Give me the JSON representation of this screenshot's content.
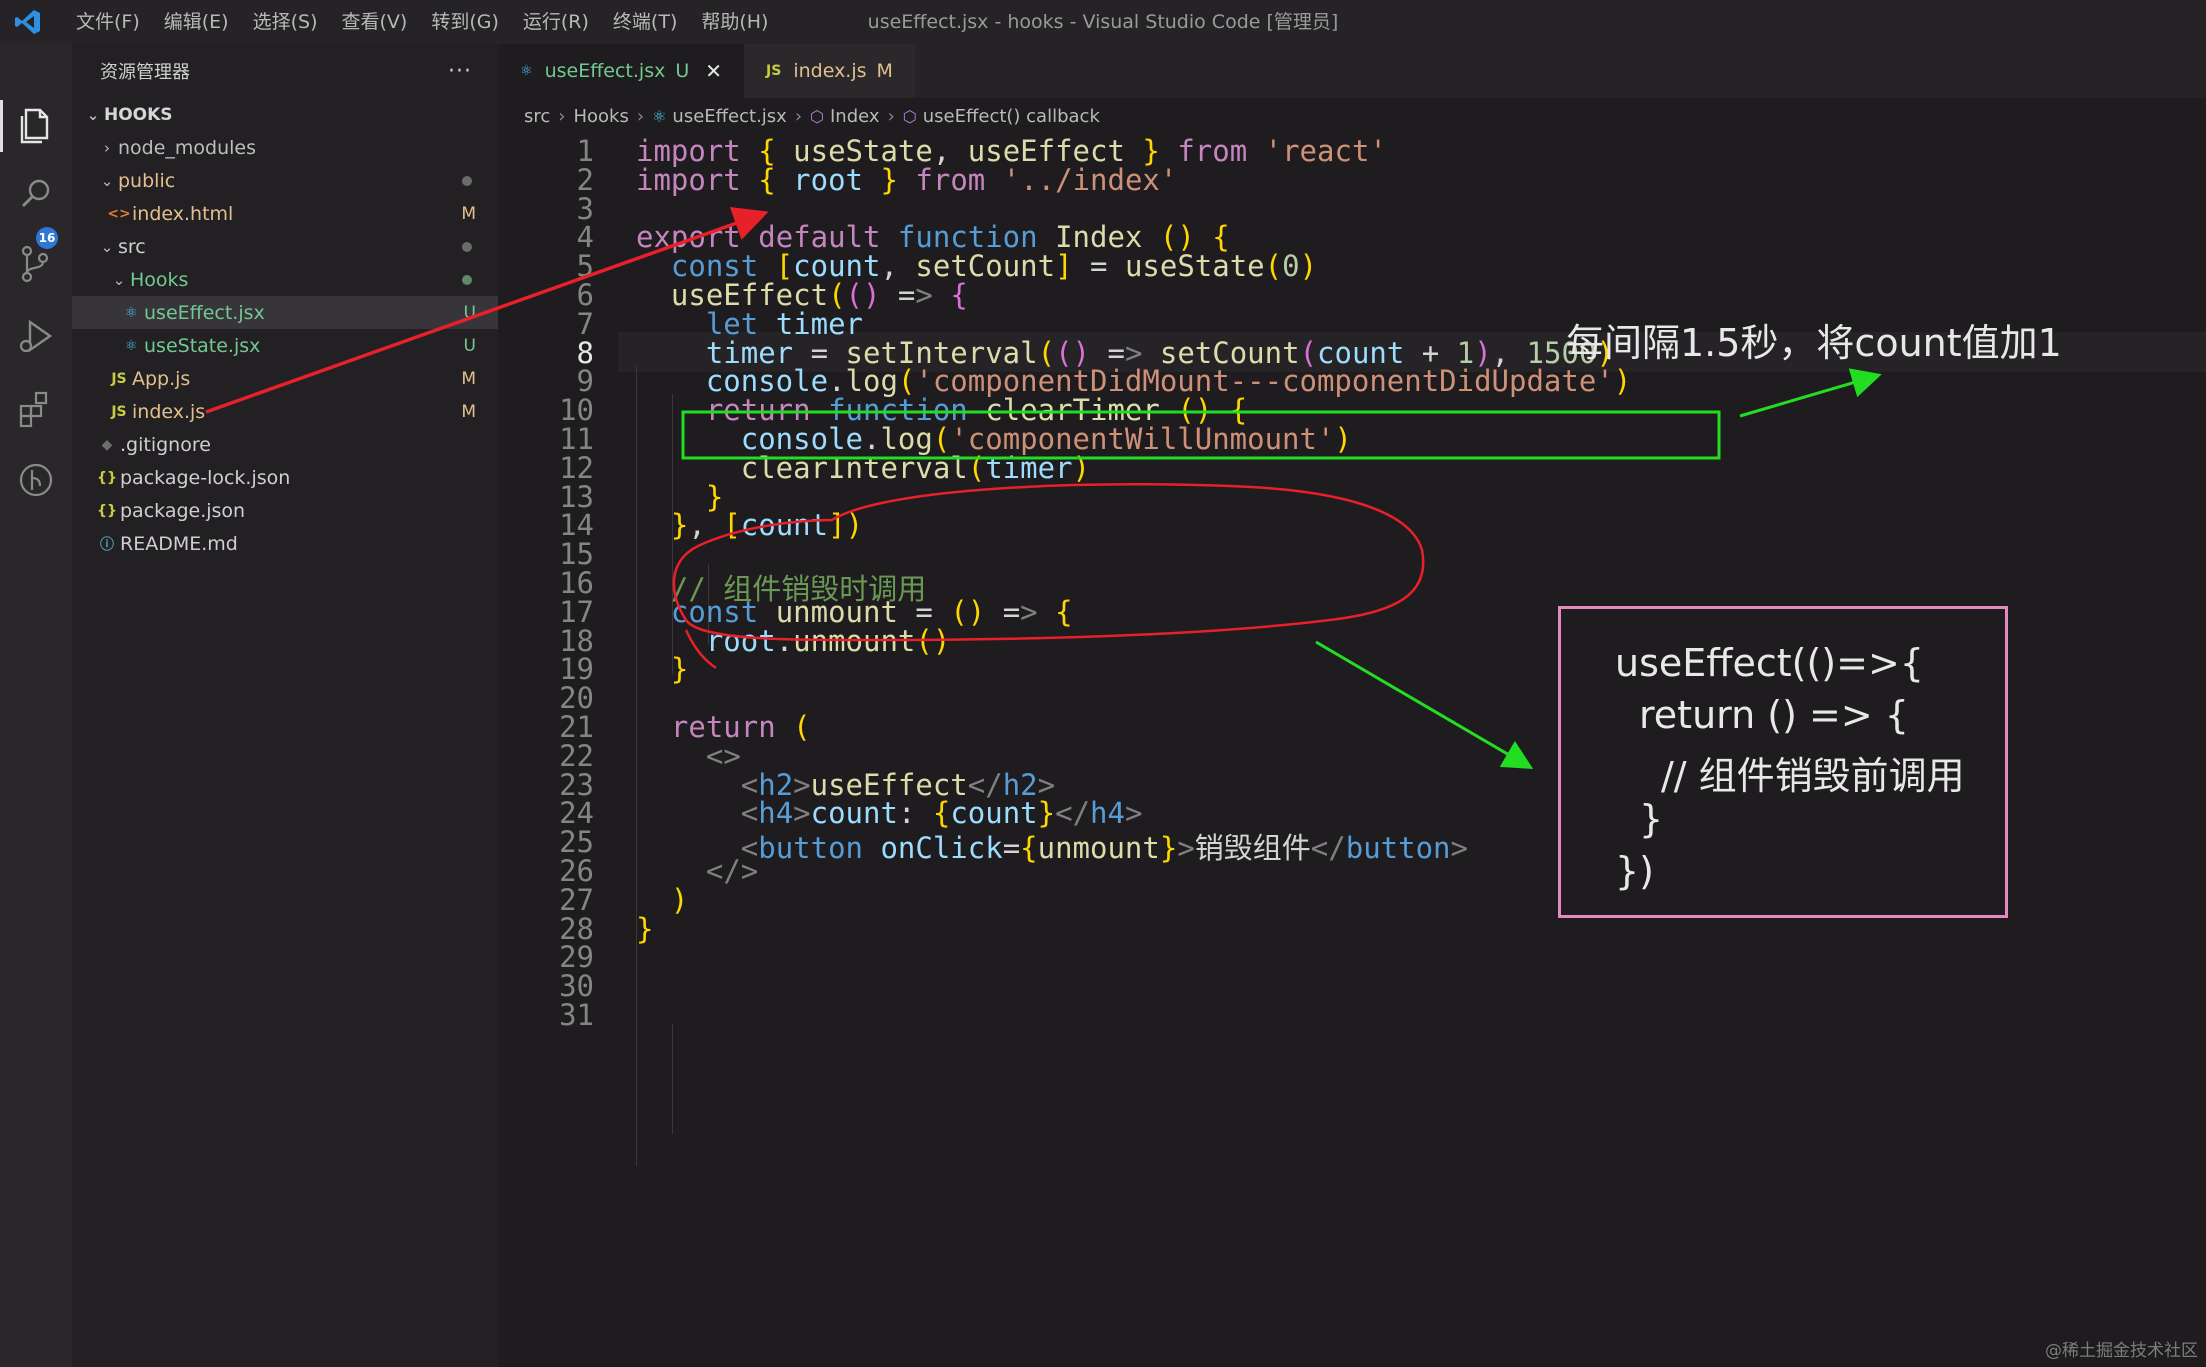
{
  "window": {
    "title": "useEffect.jsx - hooks - Visual Studio Code [管理员]",
    "menu": [
      "文件(F)",
      "编辑(E)",
      "选择(S)",
      "查看(V)",
      "转到(G)",
      "运行(R)",
      "终端(T)",
      "帮助(H)"
    ]
  },
  "activity_bar": {
    "icons": [
      "explorer-icon",
      "search-icon",
      "source-control-icon",
      "run-debug-icon",
      "extensions-icon",
      "git-graph-icon"
    ],
    "scm_badge": "16"
  },
  "sidebar": {
    "title": "资源管理器",
    "more": "···",
    "project": "HOOKS",
    "items": [
      {
        "label": "node_modules",
        "kind": "folder",
        "state": "collapsed",
        "status": ""
      },
      {
        "label": "public",
        "kind": "folder",
        "state": "expanded",
        "status": "dot"
      },
      {
        "label": "index.html",
        "kind": "html",
        "status": "M"
      },
      {
        "label": "src",
        "kind": "folder",
        "state": "expanded",
        "status": "dot"
      },
      {
        "label": "Hooks",
        "kind": "folder",
        "state": "expanded",
        "status": "dot"
      },
      {
        "label": "useEffect.jsx",
        "kind": "react",
        "status": "U"
      },
      {
        "label": "useState.jsx",
        "kind": "react",
        "status": "U"
      },
      {
        "label": "App.js",
        "kind": "js",
        "status": "M"
      },
      {
        "label": "index.js",
        "kind": "js",
        "status": "M"
      },
      {
        "label": ".gitignore",
        "kind": "gitignore",
        "status": ""
      },
      {
        "label": "package-lock.json",
        "kind": "json",
        "status": ""
      },
      {
        "label": "package.json",
        "kind": "json",
        "status": ""
      },
      {
        "label": "README.md",
        "kind": "info",
        "status": ""
      }
    ]
  },
  "tabs": [
    {
      "label": "useEffect.jsx",
      "icon": "react-icon",
      "status": "U",
      "active": true
    },
    {
      "label": "index.js",
      "icon": "JS",
      "status": "M",
      "active": false
    }
  ],
  "breadcrumb": [
    "src",
    "Hooks",
    "useEffect.jsx",
    "Index",
    "useEffect() callback"
  ],
  "editor": {
    "current_line": 8,
    "lines": [
      "import { useState, useEffect } from 'react'",
      "import { root } from '../index'",
      "",
      "export default function Index () {",
      "  const [count, setCount] = useState(0)",
      "  useEffect(() => {",
      "    let timer",
      "    timer = setInterval(() => setCount(count + 1), 1500)",
      "    console.log('componentDidMount---componentDidUpdate')",
      "    return function clearTimer () {",
      "      console.log('componentWillUnmount')",
      "      clearInterval(timer)",
      "    }",
      "  }, [count])",
      "",
      "  // 组件销毁时调用",
      "  const unmount = () => {",
      "    root.unmount()",
      "  }",
      "",
      "  return (",
      "    <>",
      "      <h2>useEffect</h2>",
      "      <h4>count: {count}</h4>",
      "      <button onClick={unmount}>销毁组件</button>",
      "    </>",
      "  )",
      "}",
      "",
      "",
      ""
    ]
  },
  "annotations": {
    "note": "每间隔1.5秒，将count值加1",
    "box_lines": [
      "useEffect(()=>{",
      "return () => {",
      "// 组件销毁前调用",
      "}",
      "})"
    ],
    "colors": {
      "red": "#e8202a",
      "green": "#22dd22",
      "pink": "#e48ac0"
    }
  },
  "watermark": "@稀土掘金技术社区"
}
